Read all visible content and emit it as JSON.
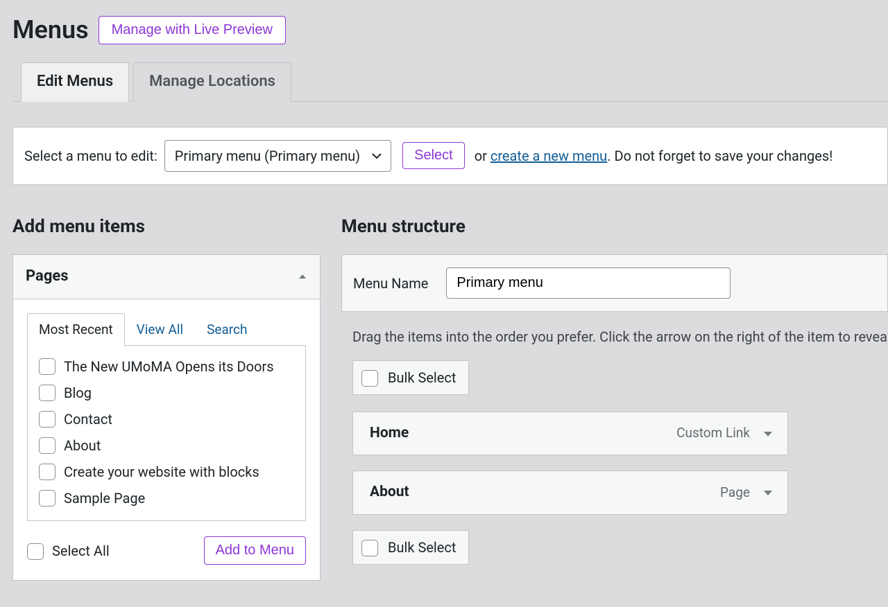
{
  "header": {
    "title": "Menus",
    "live_preview_label": "Manage with Live Preview"
  },
  "tabs": {
    "edit": "Edit Menus",
    "locations": "Manage Locations"
  },
  "select_bar": {
    "label": "Select a menu to edit:",
    "dropdown_value": "Primary menu (Primary menu)",
    "select_button": "Select",
    "or": "or",
    "create_link": "create a new menu",
    "suffix": ". Do not forget to save your changes!"
  },
  "left": {
    "heading": "Add menu items",
    "postbox_title": "Pages",
    "subtabs": {
      "recent": "Most Recent",
      "all": "View All",
      "search": "Search"
    },
    "items": [
      "The New UMoMA Opens its Doors",
      "Blog",
      "Contact",
      "About",
      "Create your website with blocks",
      "Sample Page"
    ],
    "select_all": "Select All",
    "add_button": "Add to Menu"
  },
  "right": {
    "heading": "Menu structure",
    "menu_name_label": "Menu Name",
    "menu_name_value": "Primary menu",
    "instructions": "Drag the items into the order you prefer. Click the arrow on the right of the item to reveal additional options.",
    "bulk_select": "Bulk Select",
    "items": [
      {
        "title": "Home",
        "type": "Custom Link"
      },
      {
        "title": "About",
        "type": "Page"
      }
    ]
  }
}
